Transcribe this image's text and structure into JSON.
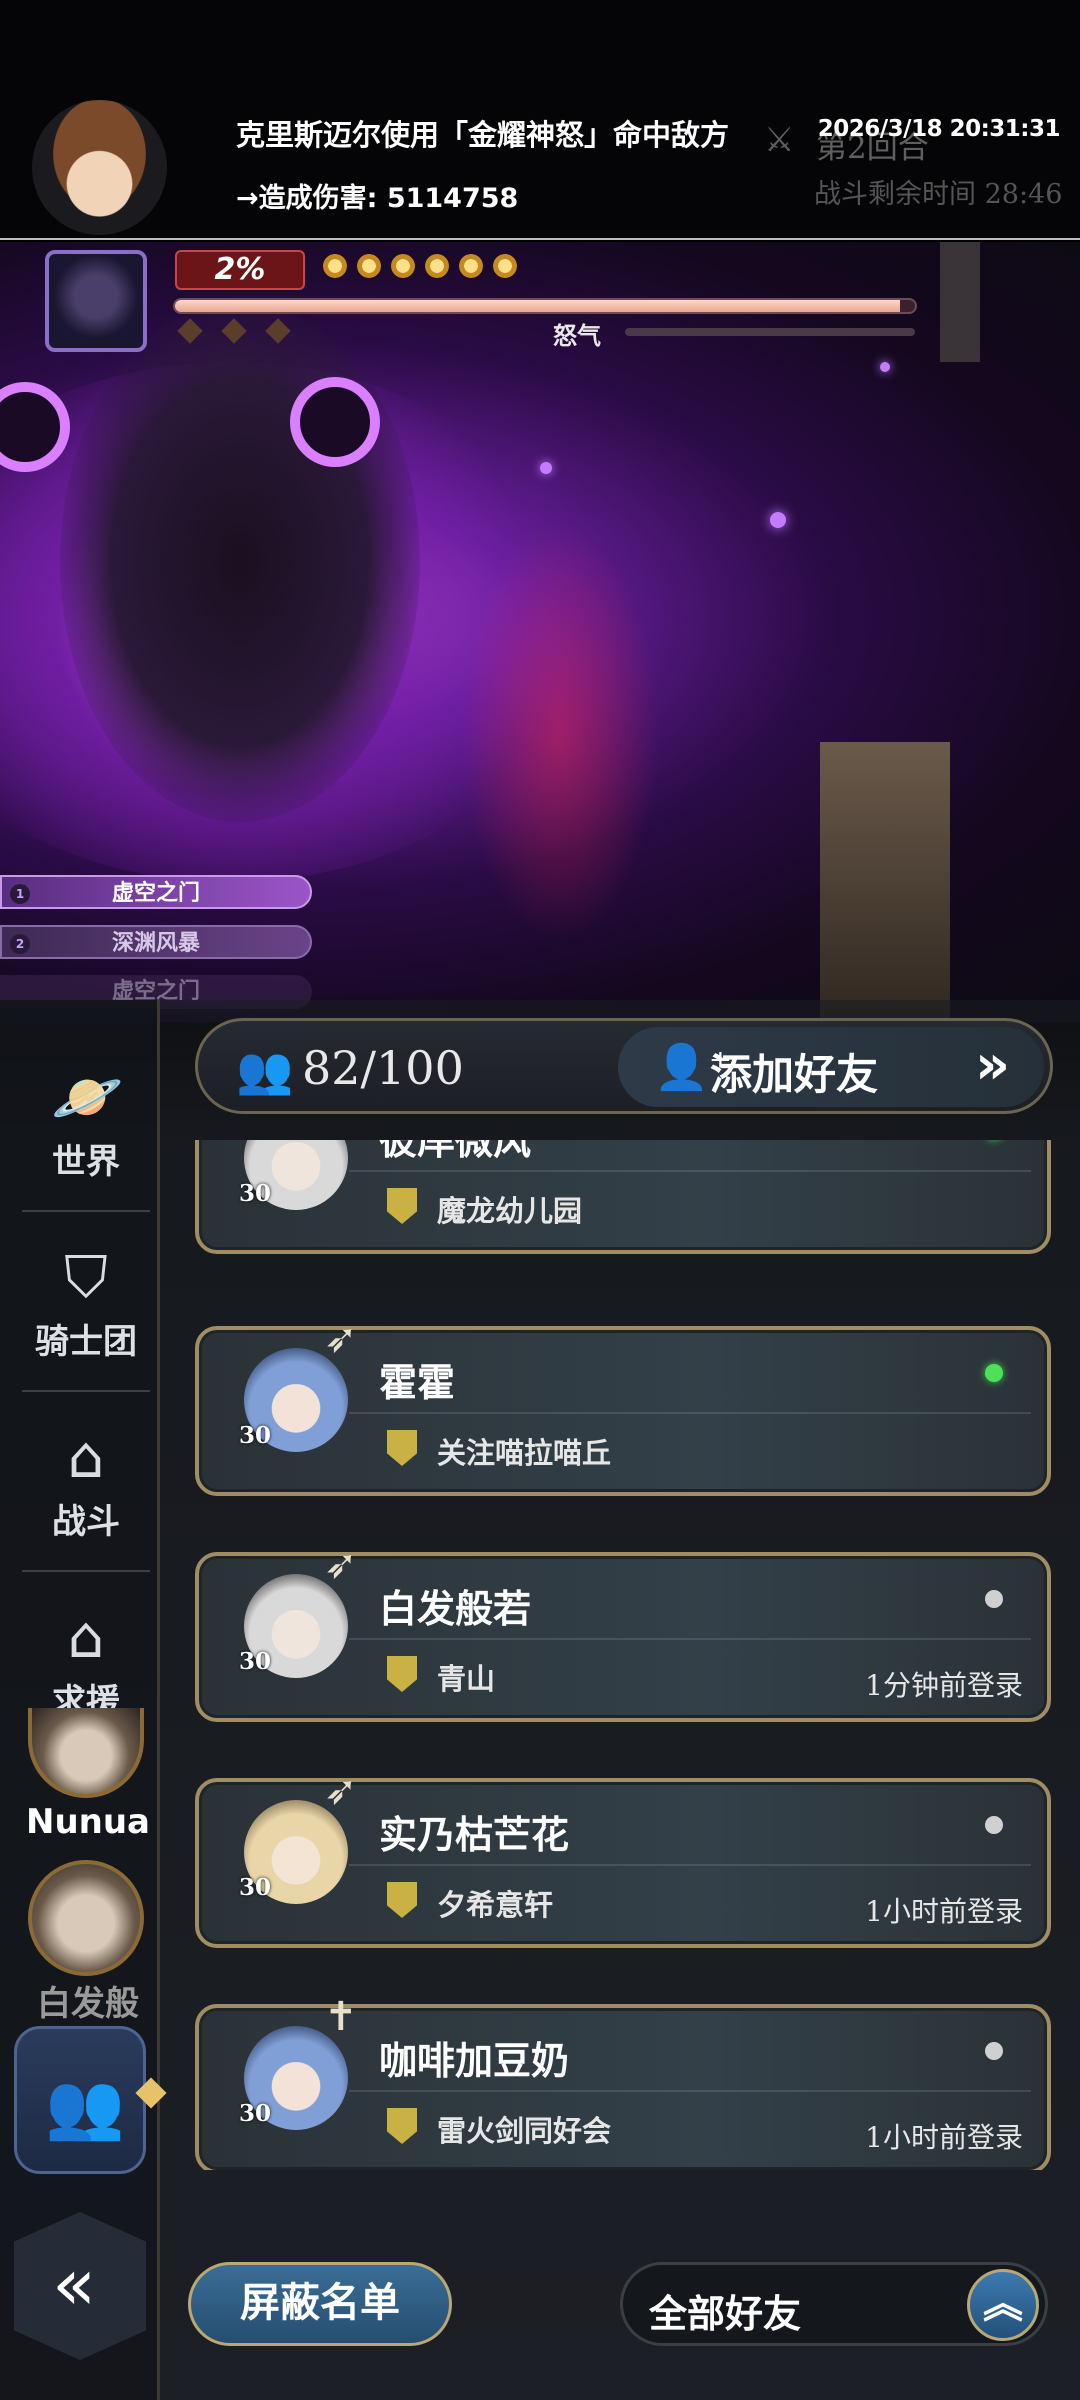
{
  "banner": {
    "line1": "克里斯迈尔使用「金耀神怒」命中敌方",
    "line2": "→造成伤害: 5114758",
    "round": "第2回合",
    "battle_time": "战斗剩余时间 28:46",
    "timestamp": "2026/3/18 20:31:31"
  },
  "boss": {
    "hp_percent_label": "2%",
    "hp_fraction": 0.98,
    "rage_label": "怒气",
    "skills": [
      "虚空之门",
      "深渊风暴",
      "虚空之门"
    ]
  },
  "sidebar": {
    "items": [
      {
        "label": "世界",
        "icon": "planet-icon"
      },
      {
        "label": "骑士团",
        "icon": "shield-icon"
      },
      {
        "label": "战斗",
        "icon": "house-icon"
      },
      {
        "label": "求援",
        "icon": "house-icon"
      }
    ],
    "shortcuts": [
      "Nunua",
      "白发般"
    ]
  },
  "friends": {
    "count": "82/100",
    "add_friend_label": "添加好友",
    "list": [
      {
        "name": "彼岸微风",
        "level": "30",
        "guild": "魔龙幼儿园",
        "status": "online",
        "last_login": ""
      },
      {
        "name": "霍霍",
        "level": "30",
        "guild": "关注喵拉喵丘",
        "status": "online",
        "last_login": ""
      },
      {
        "name": "白发般若",
        "level": "30",
        "guild": "青山",
        "status": "offline",
        "last_login": "1分钟前登录"
      },
      {
        "name": "实乃枯芒花",
        "level": "30",
        "guild": "夕希意轩",
        "status": "offline",
        "last_login": "1小时前登录"
      },
      {
        "name": "咖啡加豆奶",
        "level": "30",
        "guild": "雷火剑同好会",
        "status": "offline",
        "last_login": "1小时前登录"
      }
    ]
  },
  "footer": {
    "block_list_label": "屏蔽名单",
    "filter_value": "全部好友"
  },
  "colors": {
    "online": "#4fe05a",
    "card_border": "#a08d63",
    "hp_fill": "#ffd7c8"
  }
}
